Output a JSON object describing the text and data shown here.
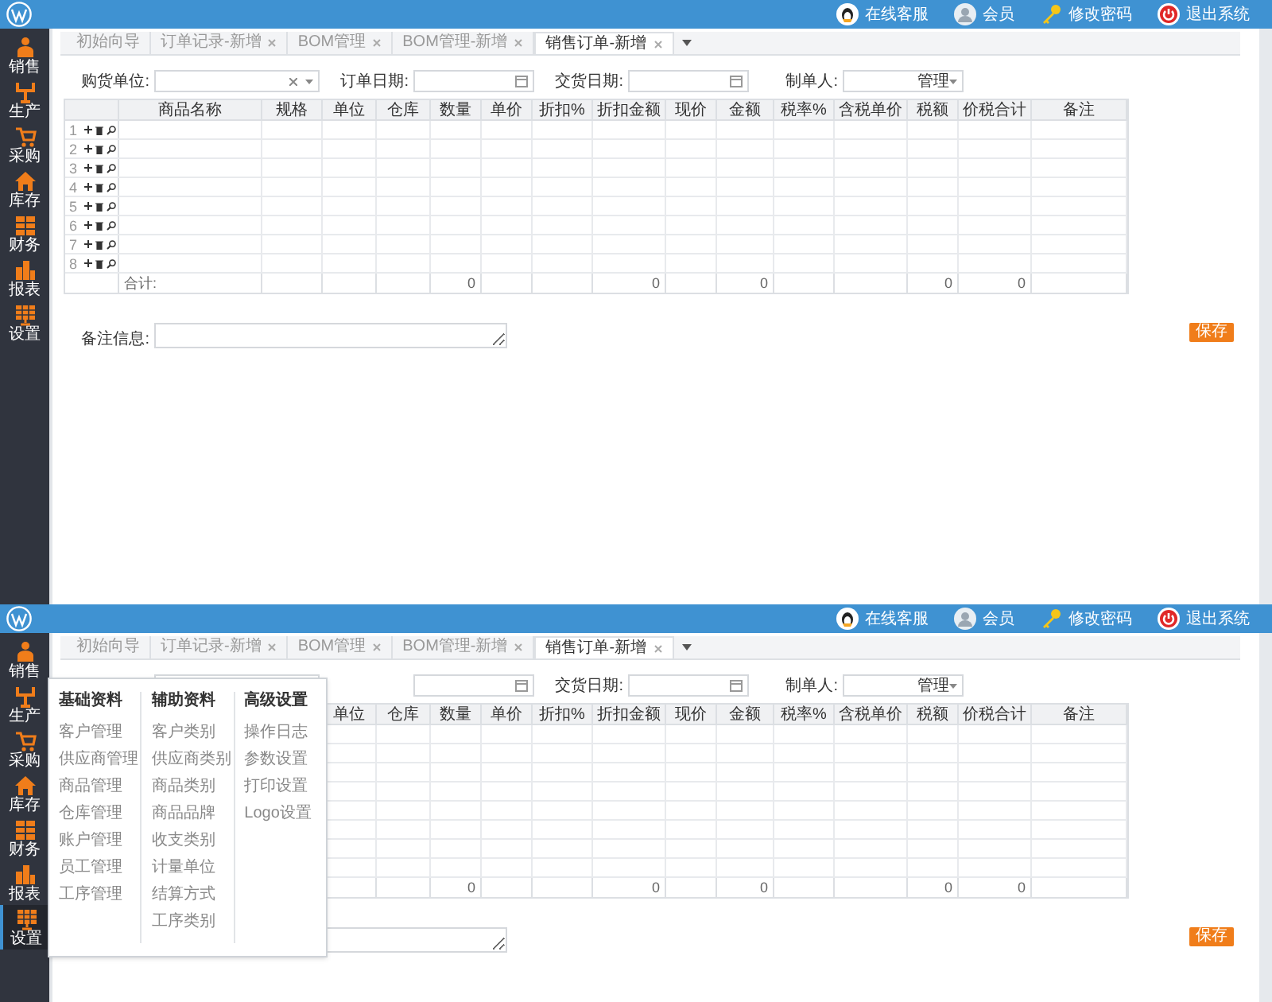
{
  "screens": [
    {
      "header": {
        "links": [
          {
            "kind": "qq",
            "label": "在线客服"
          },
          {
            "kind": "avatar",
            "label": "会员"
          },
          {
            "kind": "key",
            "label": "修改密码"
          },
          {
            "kind": "logout",
            "label": "退出系统"
          }
        ]
      },
      "sidebar": [
        {
          "kind": "sales",
          "label": "销售",
          "selected": false
        },
        {
          "kind": "production",
          "label": "生产",
          "selected": false
        },
        {
          "kind": "purchase",
          "label": "采购",
          "selected": false
        },
        {
          "kind": "stock",
          "label": "库存",
          "selected": false
        },
        {
          "kind": "finance",
          "label": "财务",
          "selected": false
        },
        {
          "kind": "report",
          "label": "报表",
          "selected": false
        },
        {
          "kind": "settings",
          "label": "设置",
          "selected": false
        }
      ],
      "tabs": [
        {
          "label": "初始向导",
          "selected": false,
          "closable": false
        },
        {
          "label": "订单记录-新增",
          "selected": false,
          "closable": true
        },
        {
          "label": "BOM管理",
          "selected": false,
          "closable": true
        },
        {
          "label": "BOM管理-新增",
          "selected": false,
          "closable": true
        },
        {
          "label": "销售订单-新增",
          "selected": true,
          "closable": true
        }
      ],
      "form": [
        {
          "kind": "combo",
          "label": "购货单位:"
        },
        {
          "kind": "date",
          "label": "订单日期:"
        },
        {
          "kind": "date",
          "label": "交货日期:"
        },
        {
          "kind": "select",
          "label": "制单人:",
          "value": "管理"
        }
      ],
      "table": {
        "columns": [
          {
            "kind": "text",
            "label": "商品名称"
          },
          {
            "kind": "text",
            "label": "规格"
          },
          {
            "kind": "text",
            "label": "单位"
          },
          {
            "kind": "text",
            "label": "仓库"
          },
          {
            "kind": "number",
            "label": "数量",
            "total": "0"
          },
          {
            "kind": "number",
            "label": "单价"
          },
          {
            "kind": "number",
            "label": "折扣%"
          },
          {
            "kind": "number",
            "label": "折扣金额",
            "total": "0"
          },
          {
            "kind": "number",
            "label": "现价"
          },
          {
            "kind": "number",
            "label": "金额",
            "total": "0"
          },
          {
            "kind": "number",
            "label": "税率%"
          },
          {
            "kind": "number",
            "label": "含税单价"
          },
          {
            "kind": "number",
            "label": "税额",
            "total": "0"
          },
          {
            "kind": "number",
            "label": "价税合计",
            "total": "0"
          },
          {
            "kind": "text",
            "label": "备注"
          }
        ],
        "rows": [
          {
            "kind": "entry",
            "number": "1"
          },
          {
            "kind": "entry",
            "number": "2"
          },
          {
            "kind": "entry",
            "number": "3"
          },
          {
            "kind": "entry",
            "number": "4"
          },
          {
            "kind": "entry",
            "number": "5"
          },
          {
            "kind": "entry",
            "number": "6"
          },
          {
            "kind": "entry",
            "number": "7"
          },
          {
            "kind": "entry",
            "number": "8"
          }
        ],
        "total_label": "合计:"
      },
      "remark": {
        "label": "备注信息:"
      },
      "save_button": "保存"
    },
    {
      "header": {
        "links": [
          {
            "kind": "qq",
            "label": "在线客服"
          },
          {
            "kind": "avatar",
            "label": "会员"
          },
          {
            "kind": "key",
            "label": "修改密码"
          },
          {
            "kind": "logout",
            "label": "退出系统"
          }
        ]
      },
      "sidebar": [
        {
          "kind": "sales",
          "label": "销售",
          "selected": false
        },
        {
          "kind": "production",
          "label": "生产",
          "selected": false
        },
        {
          "kind": "purchase",
          "label": "采购",
          "selected": false
        },
        {
          "kind": "stock",
          "label": "库存",
          "selected": false
        },
        {
          "kind": "finance",
          "label": "财务",
          "selected": false
        },
        {
          "kind": "report",
          "label": "报表",
          "selected": false
        },
        {
          "kind": "settings",
          "label": "设置",
          "selected": true
        }
      ],
      "tabs": [
        {
          "label": "初始向导",
          "selected": false,
          "closable": false
        },
        {
          "label": "订单记录-新增",
          "selected": false,
          "closable": true
        },
        {
          "label": "BOM管理",
          "selected": false,
          "closable": true
        },
        {
          "label": "BOM管理-新增",
          "selected": false,
          "closable": true
        },
        {
          "label": "销售订单-新增",
          "selected": true,
          "closable": true
        }
      ],
      "form": [
        {
          "kind": "combo"
        },
        {
          "kind": "date"
        },
        {
          "kind": "date",
          "label": "交货日期:"
        },
        {
          "kind": "select",
          "label": "制单人:",
          "value": "管理"
        }
      ],
      "table": {
        "columns": [
          {
            "kind": "text"
          },
          {
            "kind": "text"
          },
          {
            "kind": "text",
            "label": "单位"
          },
          {
            "kind": "text",
            "label": "仓库"
          },
          {
            "kind": "number",
            "label": "数量",
            "total": "0"
          },
          {
            "kind": "number",
            "label": "单价"
          },
          {
            "kind": "number",
            "label": "折扣%"
          },
          {
            "kind": "number",
            "label": "折扣金额",
            "total": "0"
          },
          {
            "kind": "number",
            "label": "现价"
          },
          {
            "kind": "number",
            "label": "金额",
            "total": "0"
          },
          {
            "kind": "number",
            "label": "税率%"
          },
          {
            "kind": "number",
            "label": "含税单价"
          },
          {
            "kind": "number",
            "label": "税额",
            "total": "0"
          },
          {
            "kind": "number",
            "label": "价税合计",
            "total": "0"
          },
          {
            "kind": "text",
            "label": "备注"
          }
        ],
        "rows": [
          {
            "kind": "blank"
          },
          {
            "kind": "blank"
          },
          {
            "kind": "blank"
          },
          {
            "kind": "blank"
          },
          {
            "kind": "blank"
          },
          {
            "kind": "blank"
          },
          {
            "kind": "blank"
          },
          {
            "kind": "blank"
          }
        ]
      },
      "save_button": "保存",
      "menu": {
        "columns": [
          {
            "heading": "基础资料",
            "items": [
              "客户管理",
              "供应商管理",
              "商品管理",
              "仓库管理",
              "账户管理",
              "员工管理",
              "工序管理"
            ]
          },
          {
            "heading": "辅助资料",
            "items": [
              "客户类别",
              "供应商类别",
              "商品类别",
              "商品品牌",
              "收支类别",
              "计量单位",
              "结算方式",
              "工序类别"
            ]
          },
          {
            "heading": "高级设置",
            "items": [
              "操作日志",
              "参数设置",
              "打印设置",
              "Logo设置"
            ]
          }
        ]
      }
    }
  ]
}
